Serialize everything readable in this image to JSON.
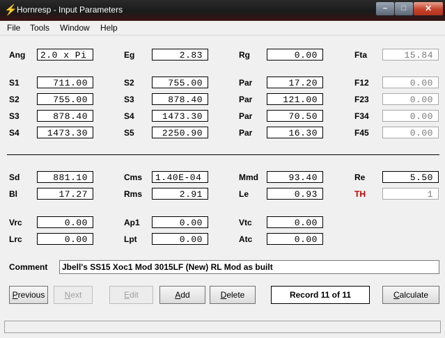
{
  "window": {
    "title": "Hornresp - Input Parameters",
    "min": "–",
    "max": "□",
    "close": "✕",
    "icon": "lightning-icon"
  },
  "menu": [
    "File",
    "Tools",
    "Window",
    "Help"
  ],
  "row0": {
    "ang_label": "Ang",
    "ang": "2.0 x Pi",
    "eg_label": "Eg",
    "eg": "2.83",
    "rg_label": "Rg",
    "rg": "0.00",
    "fta_label": "Fta",
    "fta": "15.84"
  },
  "horn": [
    {
      "s_label": "S1",
      "s": "711.00",
      "s2_label": "S2",
      "s2": "755.00",
      "par_label": "Par",
      "par": "17.20",
      "f_label": "F12",
      "f": "0.00"
    },
    {
      "s_label": "S2",
      "s": "755.00",
      "s2_label": "S3",
      "s2": "878.40",
      "par_label": "Par",
      "par": "121.00",
      "f_label": "F23",
      "f": "0.00"
    },
    {
      "s_label": "S3",
      "s": "878.40",
      "s2_label": "S4",
      "s2": "1473.30",
      "par_label": "Par",
      "par": "70.50",
      "f_label": "F34",
      "f": "0.00"
    },
    {
      "s_label": "S4",
      "s": "1473.30",
      "s2_label": "S5",
      "s2": "2250.90",
      "par_label": "Par",
      "par": "16.30",
      "f_label": "F45",
      "f": "0.00"
    }
  ],
  "driver": {
    "sd_label": "Sd",
    "sd": "881.10",
    "cms_label": "Cms",
    "cms": "1.40E-04",
    "mmd_label": "Mmd",
    "mmd": "93.40",
    "re_label": "Re",
    "re": "5.50",
    "bl_label": "Bl",
    "bl": "17.27",
    "rms_label": "Rms",
    "rms": "2.91",
    "le_label": "Le",
    "le": "0.93",
    "th_label": "TH",
    "th": "1"
  },
  "chambers": {
    "vrc_label": "Vrc",
    "vrc": "0.00",
    "ap1_label": "Ap1",
    "ap1": "0.00",
    "vtc_label": "Vtc",
    "vtc": "0.00",
    "lrc_label": "Lrc",
    "lrc": "0.00",
    "lpt_label": "Lpt",
    "lpt": "0.00",
    "atc_label": "Atc",
    "atc": "0.00"
  },
  "comment": {
    "label": "Comment",
    "value": "Jbell's SS15 Xoc1 Mod 3015LF (New) RL Mod as built"
  },
  "buttons": {
    "previous": {
      "first": "P",
      "rest": "revious"
    },
    "next": {
      "first": "N",
      "rest": "ext"
    },
    "edit": {
      "first": "E",
      "rest": "dit"
    },
    "add": {
      "first": "A",
      "rest": "dd"
    },
    "delete": {
      "first": "D",
      "rest": "elete"
    },
    "record": "Record 11 of 11",
    "calculate": {
      "first": "C",
      "rest": "alculate"
    }
  },
  "colors": {
    "label_red": "#c00000",
    "close_button": "#c4412a",
    "icon": "#f6d21a"
  }
}
